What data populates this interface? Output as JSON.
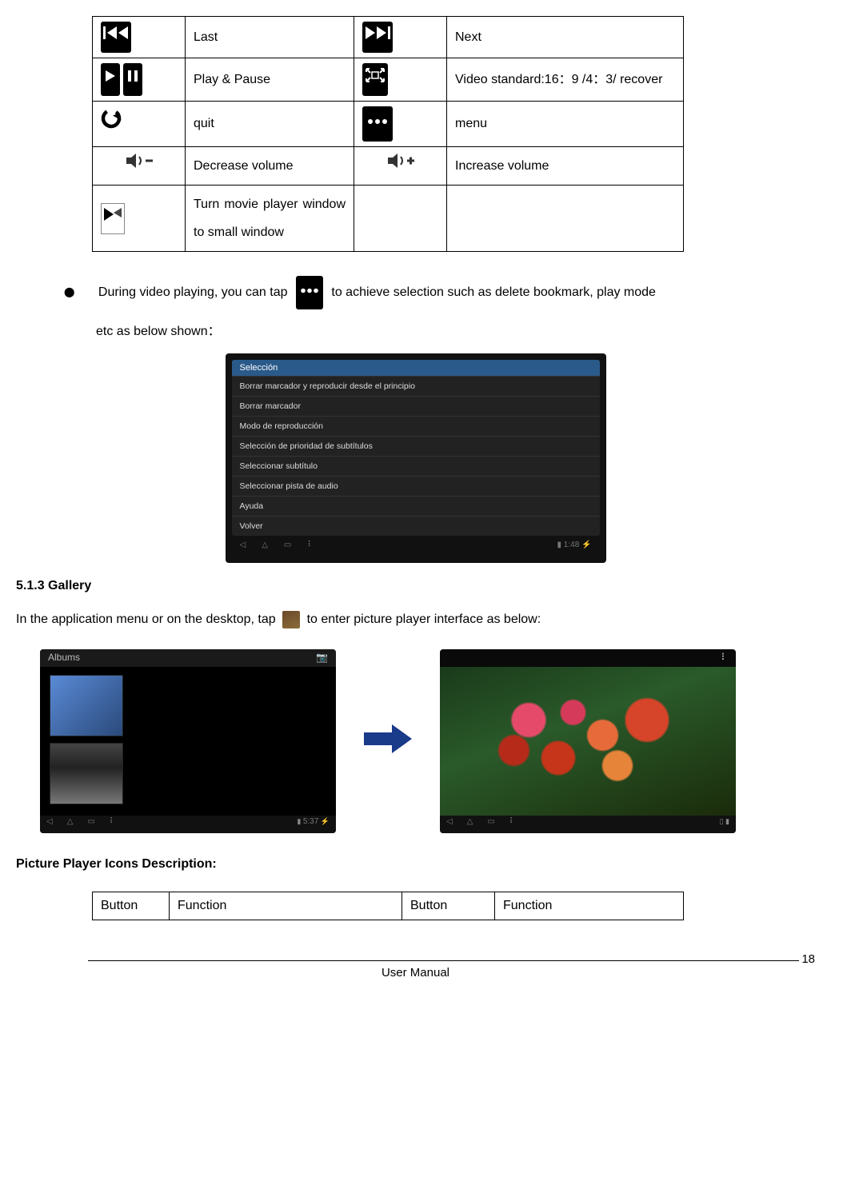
{
  "table1": {
    "r1": {
      "a": "Last",
      "b": "Next"
    },
    "r2": {
      "a": "Play & Pause",
      "b": "Video standard:16：9 /4：3/ recover"
    },
    "r3": {
      "a": "quit",
      "b": "menu"
    },
    "r4": {
      "a": "Decrease volume",
      "b": "Increase volume"
    },
    "r5": {
      "a": "Turn movie player window to small window",
      "b": ""
    }
  },
  "bullet": {
    "pre": "During video playing, you can tap",
    "post": "to achieve selection such as delete bookmark, play mode",
    "sub": "etc as below shown："
  },
  "menu": {
    "header": "Selección",
    "items": [
      "Borrar marcador y reproducir desde el principio",
      "Borrar marcador",
      "Modo de reproducción",
      "Selección de prioridad de subtítulos",
      "Seleccionar subtítulo",
      "Seleccionar pista de audio",
      "Ayuda",
      "Volver"
    ],
    "time": "1:48"
  },
  "section_gallery": "5.1.3 Gallery",
  "gallery_line": {
    "pre": "In the application menu or on the desktop, tap",
    "post": "to enter picture player interface as below:"
  },
  "albums_label": "Albums",
  "gallery_time": "5:37",
  "pic_desc_title": "Picture Player Icons Description:",
  "table2": {
    "h1": "Button",
    "h2": "Function",
    "h3": "Button",
    "h4": "Function"
  },
  "footer": {
    "title": "User Manual",
    "page": "18"
  }
}
